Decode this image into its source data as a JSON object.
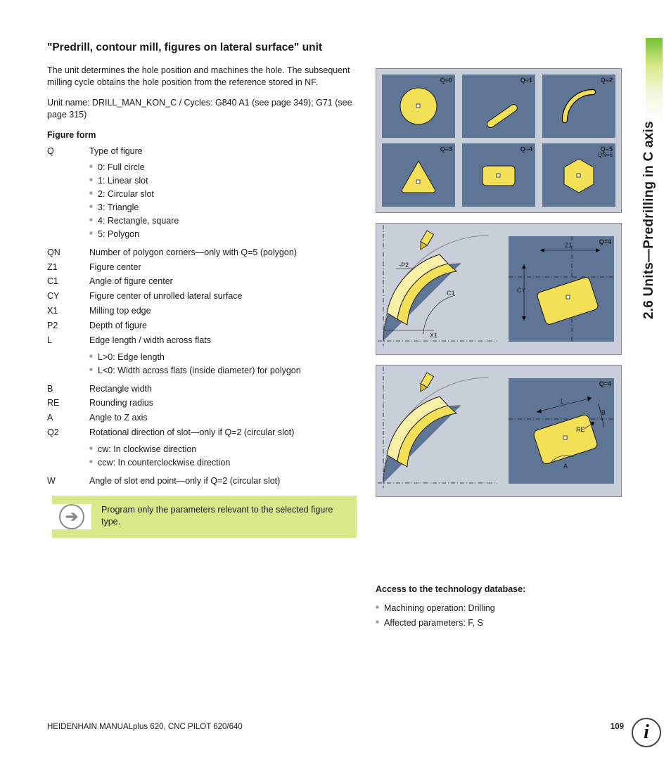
{
  "side_tab": "2.6 Units—Predrilling in C axis",
  "title": "\"Predrill, contour mill, figures on lateral surface\" unit",
  "intro": "The unit determines the hole position and machines the hole. The subsequent milling cycle obtains the hole position from the reference stored in NF.",
  "unitname": "Unit name: DRILL_MAN_KON_C / Cycles: G840 A1 (see page 349); G71 (see page 315)",
  "form_head": "Figure form",
  "params": [
    {
      "code": "Q",
      "desc": "Type of figure",
      "sub": [
        "0: Full circle",
        "1: Linear slot",
        "2: Circular slot",
        "3: Triangle",
        "4: Rectangle, square",
        "5: Polygon"
      ]
    },
    {
      "code": "QN",
      "desc": "Number of polygon corners—only with Q=5 (polygon)"
    },
    {
      "code": "Z1",
      "desc": "Figure center"
    },
    {
      "code": "C1",
      "desc": "Angle of figure center"
    },
    {
      "code": "CY",
      "desc": "Figure center of unrolled lateral surface"
    },
    {
      "code": "X1",
      "desc": "Milling top edge"
    },
    {
      "code": "P2",
      "desc": "Depth of figure"
    },
    {
      "code": "L",
      "desc": "Edge length / width across flats",
      "sub": [
        "L>0: Edge length",
        "L<0: Width across flats (inside diameter) for polygon"
      ]
    },
    {
      "code": "B",
      "desc": "Rectangle width"
    },
    {
      "code": "RE",
      "desc": "Rounding radius"
    },
    {
      "code": "A",
      "desc": "Angle to Z axis"
    },
    {
      "code": "Q2",
      "desc": "Rotational direction of slot—only if Q=2 (circular slot)",
      "sub": [
        "cw: In clockwise direction",
        "ccw: In counterclockwise direction"
      ]
    },
    {
      "code": "W",
      "desc": "Angle of slot end point—only if Q=2 (circular slot)"
    }
  ],
  "note": "Program only the parameters relevant to the selected figure type.",
  "cells": [
    "Q=0",
    "Q=1",
    "Q=2",
    "Q=3",
    "Q=4",
    "Q=5"
  ],
  "cell5_extra": "QN=6",
  "fig_right_lbl": "Q=4",
  "fig2_dims": {
    "z1": "Z1",
    "cy": "CY",
    "p2": "-P2",
    "c1": "C1",
    "x1": "X1"
  },
  "fig3_dims": {
    "l": "L",
    "b": "B",
    "re": "RE",
    "a": "A"
  },
  "tech_head": "Access to the technology database:",
  "tech_items": [
    "Machining operation: Drilling",
    "Affected parameters: F, S"
  ],
  "footer_left": "HEIDENHAIN MANUALplus 620, CNC PILOT 620/640",
  "footer_page": "109"
}
